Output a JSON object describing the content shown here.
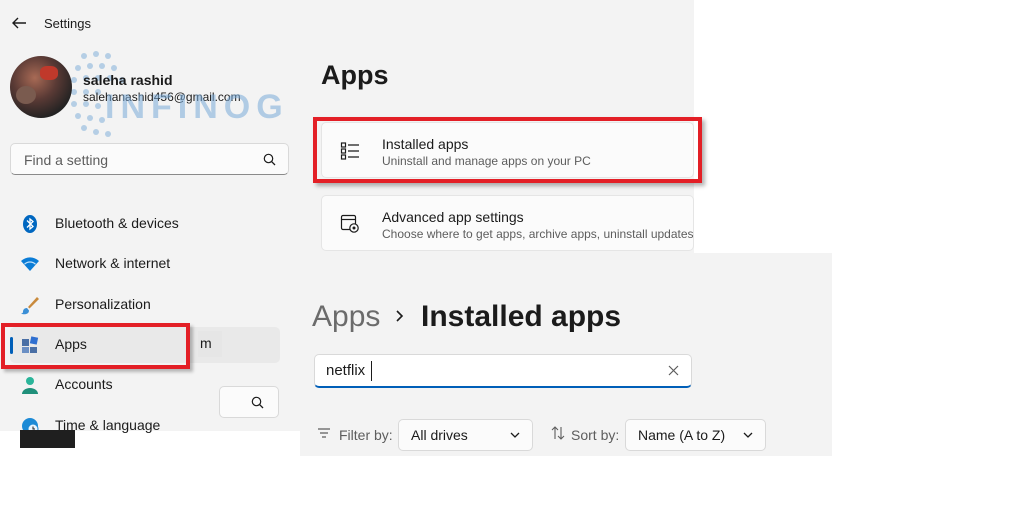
{
  "window": {
    "title": "Settings"
  },
  "user": {
    "name": "saleha rashid",
    "email": "salehanashid456@gmail.com"
  },
  "watermark": {
    "text": "INFINOG"
  },
  "search": {
    "placeholder": "Find a setting"
  },
  "sidebar": {
    "items": [
      {
        "label": "Bluetooth & devices",
        "icon": "bluetooth-icon"
      },
      {
        "label": "Network & internet",
        "icon": "wifi-icon"
      },
      {
        "label": "Personalization",
        "icon": "brush-icon"
      },
      {
        "label": "Apps",
        "icon": "apps-icon",
        "active": true
      },
      {
        "label": "Accounts",
        "icon": "person-icon"
      },
      {
        "label": "Time & language",
        "icon": "globe-clock-icon"
      }
    ],
    "overlap_fragment": "m"
  },
  "apps_page": {
    "title": "Apps",
    "cards": [
      {
        "title": "Installed apps",
        "subtitle": "Uninstall and manage apps on your PC",
        "icon": "list-icon"
      },
      {
        "title": "Advanced app settings",
        "subtitle": "Choose where to get apps, archive apps, uninstall updates",
        "icon": "app-settings-icon"
      }
    ]
  },
  "installed_apps": {
    "breadcrumb_parent": "Apps",
    "breadcrumb_current": "Installed apps",
    "search_value": "netflix",
    "filter_label": "Filter by:",
    "filter_value": "All drives",
    "sort_label": "Sort by:",
    "sort_value": "Name (A to Z)"
  },
  "colors": {
    "accent": "#005fb8",
    "highlight_box": "#e31f26",
    "background": "#f3f3f3"
  }
}
